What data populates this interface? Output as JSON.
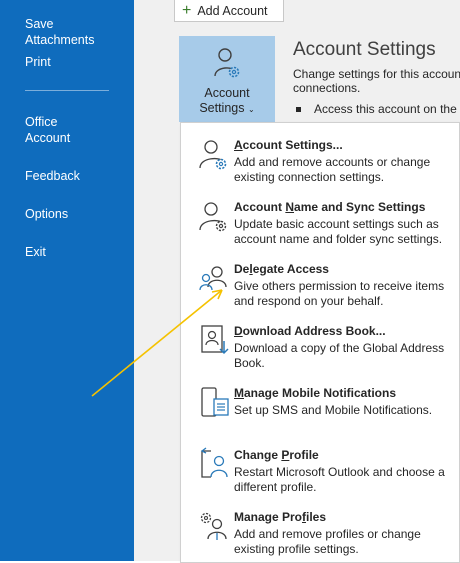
{
  "nav": {
    "items": [
      {
        "label": "Save Attachments"
      },
      {
        "label": "Print"
      },
      {
        "label": "Office Account"
      },
      {
        "label": "Feedback"
      },
      {
        "label": "Options"
      },
      {
        "label": "Exit"
      }
    ]
  },
  "toolbar": {
    "add_account_label": "Add Account"
  },
  "account_settings_button": {
    "line1": "Account",
    "line2": "Settings"
  },
  "settings_panel": {
    "title": "Account Settings",
    "desc_line1": "Change settings for this accoun",
    "desc_line2": "connections.",
    "bullet": "Access this account on the"
  },
  "menu": {
    "items": [
      {
        "title_pre": "",
        "title_ul": "A",
        "title_post": "ccount Settings...",
        "desc": "Add and remove accounts or change existing connection settings.",
        "icon": "account-settings-icon"
      },
      {
        "title_pre": "Account ",
        "title_ul": "N",
        "title_post": "ame and Sync Settings",
        "desc": "Update basic account settings such as account name and folder sync settings.",
        "icon": "account-name-sync-icon"
      },
      {
        "title_pre": "De",
        "title_ul": "l",
        "title_post": "egate Access",
        "desc": "Give others permission to receive items and respond on your behalf.",
        "icon": "delegate-access-icon"
      },
      {
        "title_pre": "",
        "title_ul": "D",
        "title_post": "ownload Address Book...",
        "desc": "Download a copy of the Global Address Book.",
        "icon": "address-book-icon"
      },
      {
        "title_pre": "",
        "title_ul": "M",
        "title_post": "anage Mobile Notifications",
        "desc": "Set up SMS and Mobile Notifications.",
        "icon": "mobile-notifications-icon"
      },
      {
        "title_pre": "Change ",
        "title_ul": "P",
        "title_post": "rofile",
        "desc": "Restart Microsoft Outlook and choose a different profile.",
        "icon": "change-profile-icon"
      },
      {
        "title_pre": "Manage Pro",
        "title_ul": "f",
        "title_post": "iles",
        "desc": "Add and remove profiles or change existing profile settings.",
        "icon": "manage-profiles-icon"
      }
    ]
  },
  "colors": {
    "nav_bg": "#0f6cbd",
    "button_selected": "#a7cbe9",
    "arrow": "#f5c200",
    "icon_blue": "#2a7ab9"
  }
}
